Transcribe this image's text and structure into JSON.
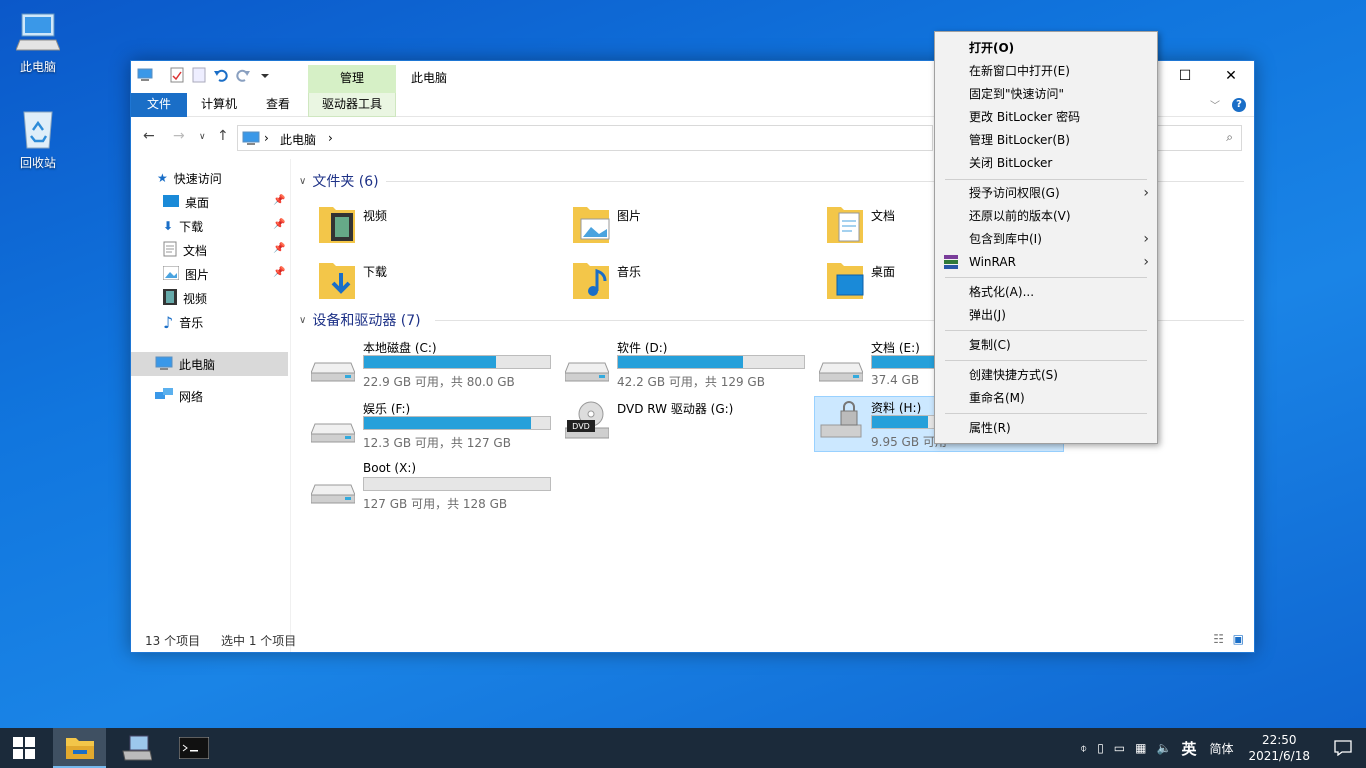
{
  "desktop": {
    "icons": [
      {
        "label": "此电脑"
      },
      {
        "label": "回收站"
      }
    ]
  },
  "window": {
    "title": "此电脑",
    "context_tab": "管理",
    "tabs": [
      "文件",
      "计算机",
      "查看",
      "驱动器工具"
    ],
    "address_crumb": "此电脑",
    "controls": {
      "maximize": "☐",
      "close": "✕"
    }
  },
  "nav": {
    "quick_access": "快速访问",
    "items": [
      "桌面",
      "下载",
      "文档",
      "图片",
      "视频",
      "音乐"
    ],
    "this_pc": "此电脑",
    "network": "网络"
  },
  "folders_section": {
    "header": "文件夹 (6)",
    "items": [
      "视频",
      "图片",
      "文档",
      "下载",
      "音乐",
      "桌面"
    ]
  },
  "drives_section": {
    "header": "设备和驱动器 (7)",
    "items": [
      {
        "name": "本地磁盘 (C:)",
        "size": "22.9 GB 可用，共 80.0 GB",
        "used": 0.71
      },
      {
        "name": "软件 (D:)",
        "size": "42.2 GB 可用，共 129 GB",
        "used": 0.67
      },
      {
        "name": "文档 (E:)",
        "size": "37.4 GB",
        "used": 0.5
      },
      {
        "name": "娱乐 (F:)",
        "size": "12.3 GB 可用，共 127 GB",
        "used": 0.9
      },
      {
        "name": "DVD RW 驱动器 (G:)",
        "size": "",
        "used": 0
      },
      {
        "name": "资料 (H:)",
        "size": "9.95 GB 可用",
        "used": 0.3
      },
      {
        "name": "Boot (X:)",
        "size": "127 GB 可用，共 128 GB",
        "used": 0.0
      }
    ]
  },
  "status": {
    "count": "13 个项目",
    "selected": "选中 1 个项目"
  },
  "context_menu": {
    "items": [
      "打开(O)",
      "在新窗口中打开(E)",
      "固定到\"快速访问\"",
      "更改 BitLocker 密码",
      "管理 BitLocker(B)",
      "关闭 BitLocker",
      "授予访问权限(G)",
      "还原以前的版本(V)",
      "包含到库中(I)",
      "WinRAR",
      "格式化(A)...",
      "弹出(J)",
      "复制(C)",
      "创建快捷方式(S)",
      "重命名(M)",
      "属性(R)"
    ]
  },
  "taskbar": {
    "ime": "英",
    "ime_mode": "简体",
    "time": "22:50",
    "date": "2021/6/18"
  },
  "colors": {
    "accent": "#1a6ec7",
    "drive_fill": "#26a0da",
    "selection": "#cce8ff",
    "taskbar": "#1b2a3a"
  }
}
